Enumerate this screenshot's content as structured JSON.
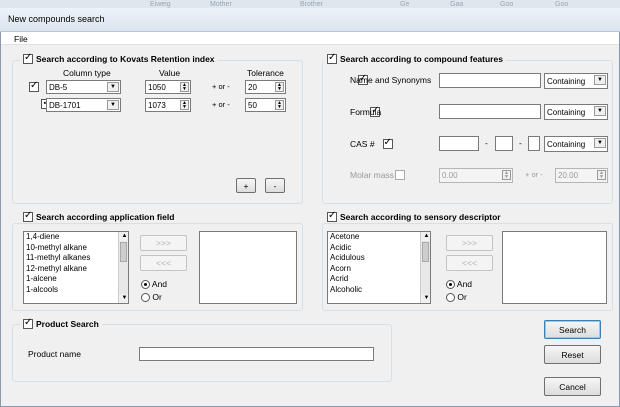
{
  "window": {
    "title": "New compounds search"
  },
  "menu": {
    "file": "File"
  },
  "kovats": {
    "title": "Search according to Kovats Retention index",
    "checked": true,
    "col_column_type": "Column type",
    "col_value": "Value",
    "col_tolerance": "Tolerance",
    "rows": [
      {
        "checked": true,
        "column_type": "DB-5",
        "value": "1050",
        "plusminus": "+ or -",
        "tolerance": "20"
      },
      {
        "checked": true,
        "column_type": "DB-1701",
        "value": "1073",
        "plusminus": "+ or -",
        "tolerance": "50"
      }
    ],
    "add_label": "+",
    "remove_label": "-"
  },
  "features": {
    "title": "Search according to compound features",
    "checked": true,
    "name_label": "Name and Synonyms",
    "name_mode": "Containing",
    "formula_label": "Formula",
    "formula_mode": "Containing",
    "cas_label": "CAS #",
    "cas_sep": "-",
    "cas_mode": "Containing",
    "molar_label": "Molar mass",
    "molar_value": "0.00",
    "molar_plusminus": "+ or -",
    "molar_tolerance": "20.00"
  },
  "application": {
    "title": "Search according application field",
    "checked": true,
    "items": [
      "1,4-diene",
      "10-methyl alkane",
      "11-methyl alkanes",
      "12-methyl alkane",
      "1-alcene",
      "1-alcools"
    ],
    "add_label": ">>>",
    "remove_label": "<<<",
    "and_label": "And",
    "or_label": "Or"
  },
  "sensory": {
    "title": "Search according to sensory descriptor",
    "checked": true,
    "items": [
      "Acetone",
      "Acidic",
      "Acidulous",
      "Acorn",
      "Acrid",
      "Alcoholic"
    ],
    "add_label": ">>>",
    "remove_label": "<<<",
    "and_label": "And",
    "or_label": "Or"
  },
  "product": {
    "title": "Product Search",
    "checked": true,
    "name_label": "Product name",
    "name_value": ""
  },
  "actions": {
    "search": "Search",
    "reset": "Reset",
    "cancel": "Cancel"
  }
}
